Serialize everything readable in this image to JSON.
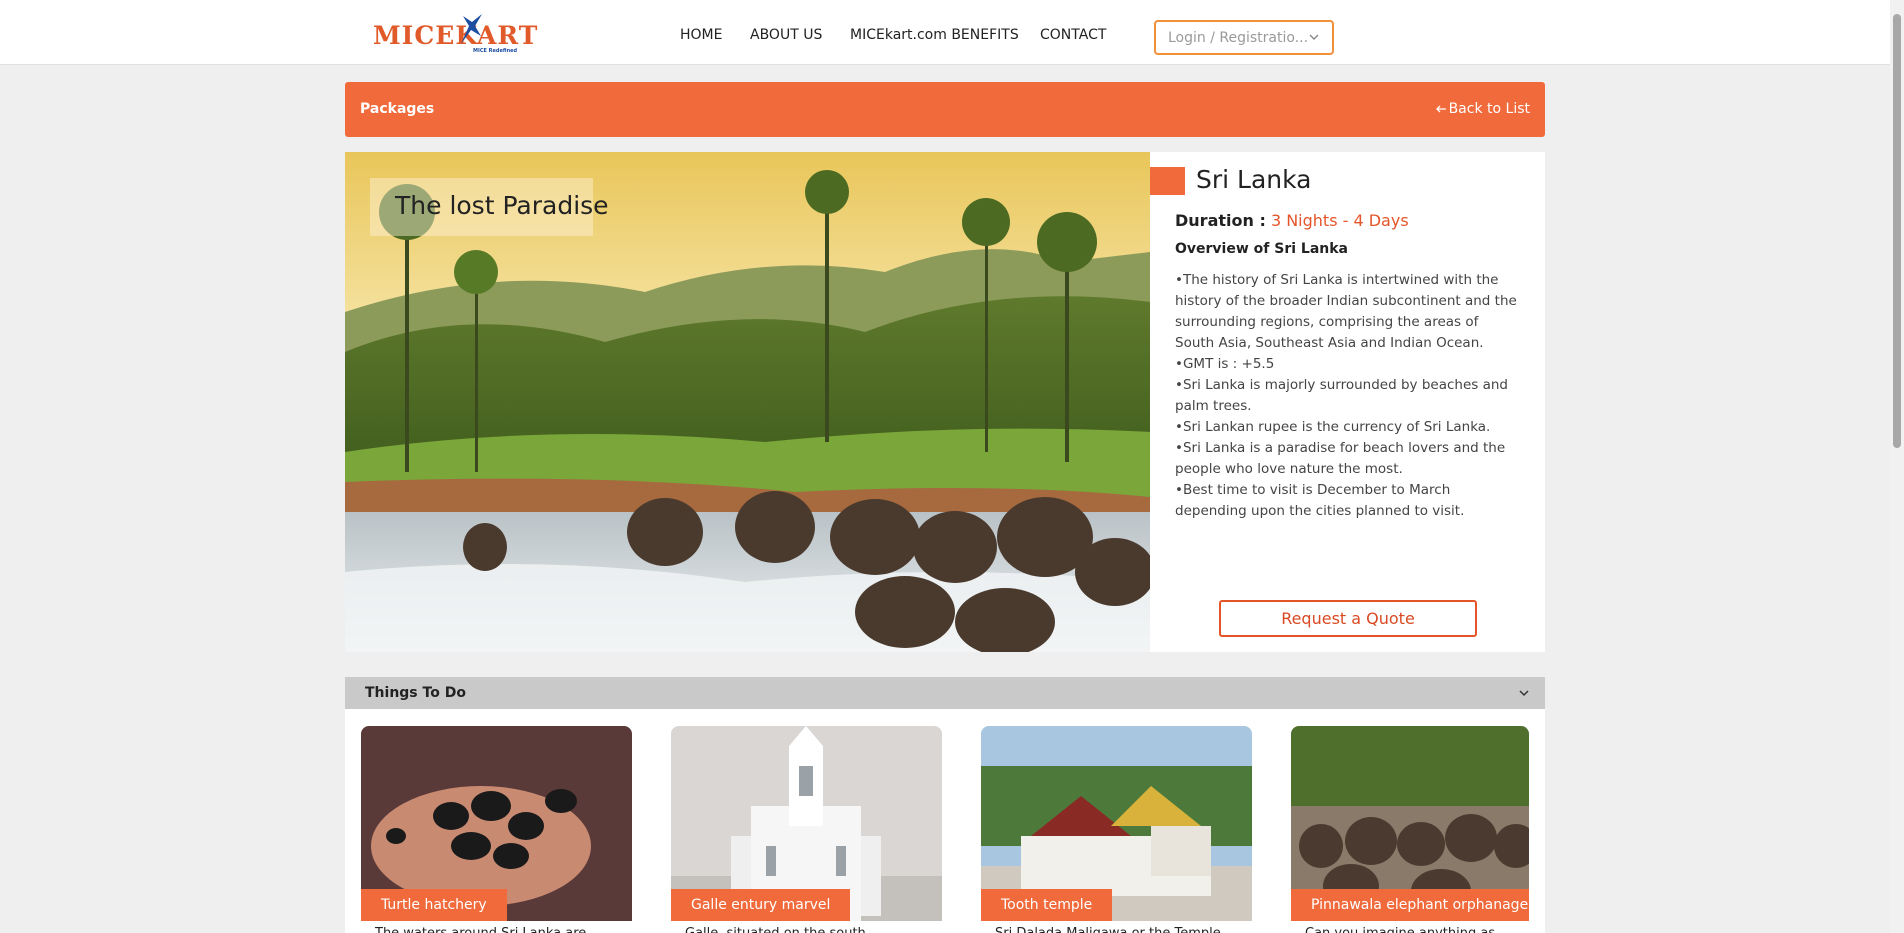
{
  "header": {
    "logo_text": "MICEKART",
    "logo_tagline": "MICE Redefined",
    "nav": [
      "HOME",
      "ABOUT US",
      "MICEkart.com BENEFITS",
      "CONTACT"
    ],
    "login_select": "Login / Registratio..."
  },
  "packages_bar": {
    "title": "Packages",
    "back_label": "Back to List"
  },
  "hero": {
    "caption": "The lost Paradise"
  },
  "info": {
    "title": "Sri Lanka",
    "duration_label": "Duration :",
    "duration_value": "3 Nights - 4 Days",
    "overview_heading": "Overview of Sri Lanka",
    "overview_lines": [
      "•The history of Sri Lanka is intertwined with the history of the broader Indian subcontinent and the surrounding regions, comprising the areas of South Asia, Southeast Asia and Indian Ocean.",
      "•GMT is : +5.5",
      "•Sri Lanka is majorly surrounded by beaches and palm trees.",
      "•Sri Lankan rupee is the currency of Sri Lanka.",
      "•Sri Lanka is a paradise for beach lovers and the people who love nature the most.",
      "•Best time to visit is December to March depending upon the cities planned to visit."
    ],
    "quote_button": "Request a Quote"
  },
  "things_to_do": {
    "title": "Things To Do",
    "cards": [
      {
        "label": "Turtle hatchery",
        "desc": "The waters around Sri Lanka are..."
      },
      {
        "label": "Galle entury marvel",
        "desc": "Galle, situated on the south..."
      },
      {
        "label": "Tooth temple",
        "desc": "Sri Dalada Maligawa or the Temple..."
      },
      {
        "label": "Pinnawala elephant orphanage",
        "desc": "Can you imagine anything as..."
      }
    ]
  },
  "colors": {
    "accent": "#f06a3b",
    "accent_text": "#e4552a",
    "login_border": "#f0913a",
    "things_bar": "#c9c9c9",
    "page_bg": "#efefef"
  },
  "icons": [
    "chevron-down-icon",
    "arrow-left-icon",
    "logo-star-icon"
  ]
}
